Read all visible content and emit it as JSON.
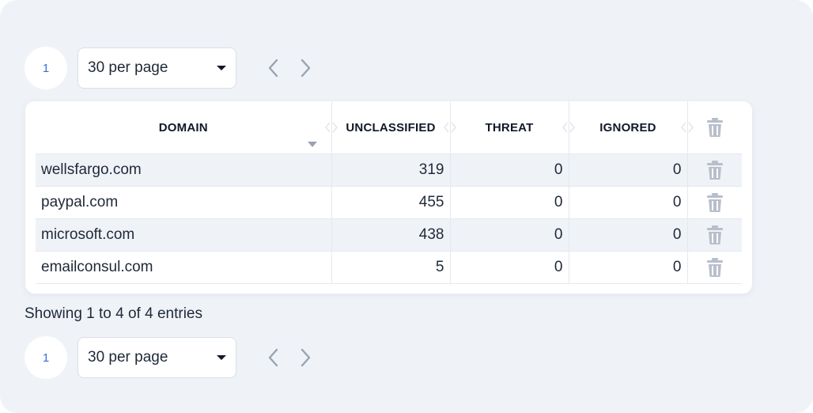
{
  "pagination": {
    "current_page": "1",
    "per_page": "30 per page"
  },
  "table": {
    "headers": {
      "domain": "DOMAIN",
      "unclassified": "UNCLASSIFIED",
      "threat": "THREAT",
      "ignored": "IGNORED"
    },
    "rows": [
      {
        "domain": "wellsfargo.com",
        "unclassified": "319",
        "threat": "0",
        "ignored": "0"
      },
      {
        "domain": "paypal.com",
        "unclassified": "455",
        "threat": "0",
        "ignored": "0"
      },
      {
        "domain": "microsoft.com",
        "unclassified": "438",
        "threat": "0",
        "ignored": "0"
      },
      {
        "domain": "emailconsul.com",
        "unclassified": "5",
        "threat": "0",
        "ignored": "0"
      }
    ]
  },
  "summary": "Showing 1 to 4 of 4 entries",
  "icons": {
    "prev": "chevron-left-icon",
    "next": "chevron-right-icon",
    "delete": "trash-icon",
    "sort": "sort-icon"
  },
  "colors": {
    "accent": "#3b6fd8",
    "background": "#eff3f8",
    "row_stripe": "#eff3f8",
    "icon_gray": "#9aa3b2"
  }
}
